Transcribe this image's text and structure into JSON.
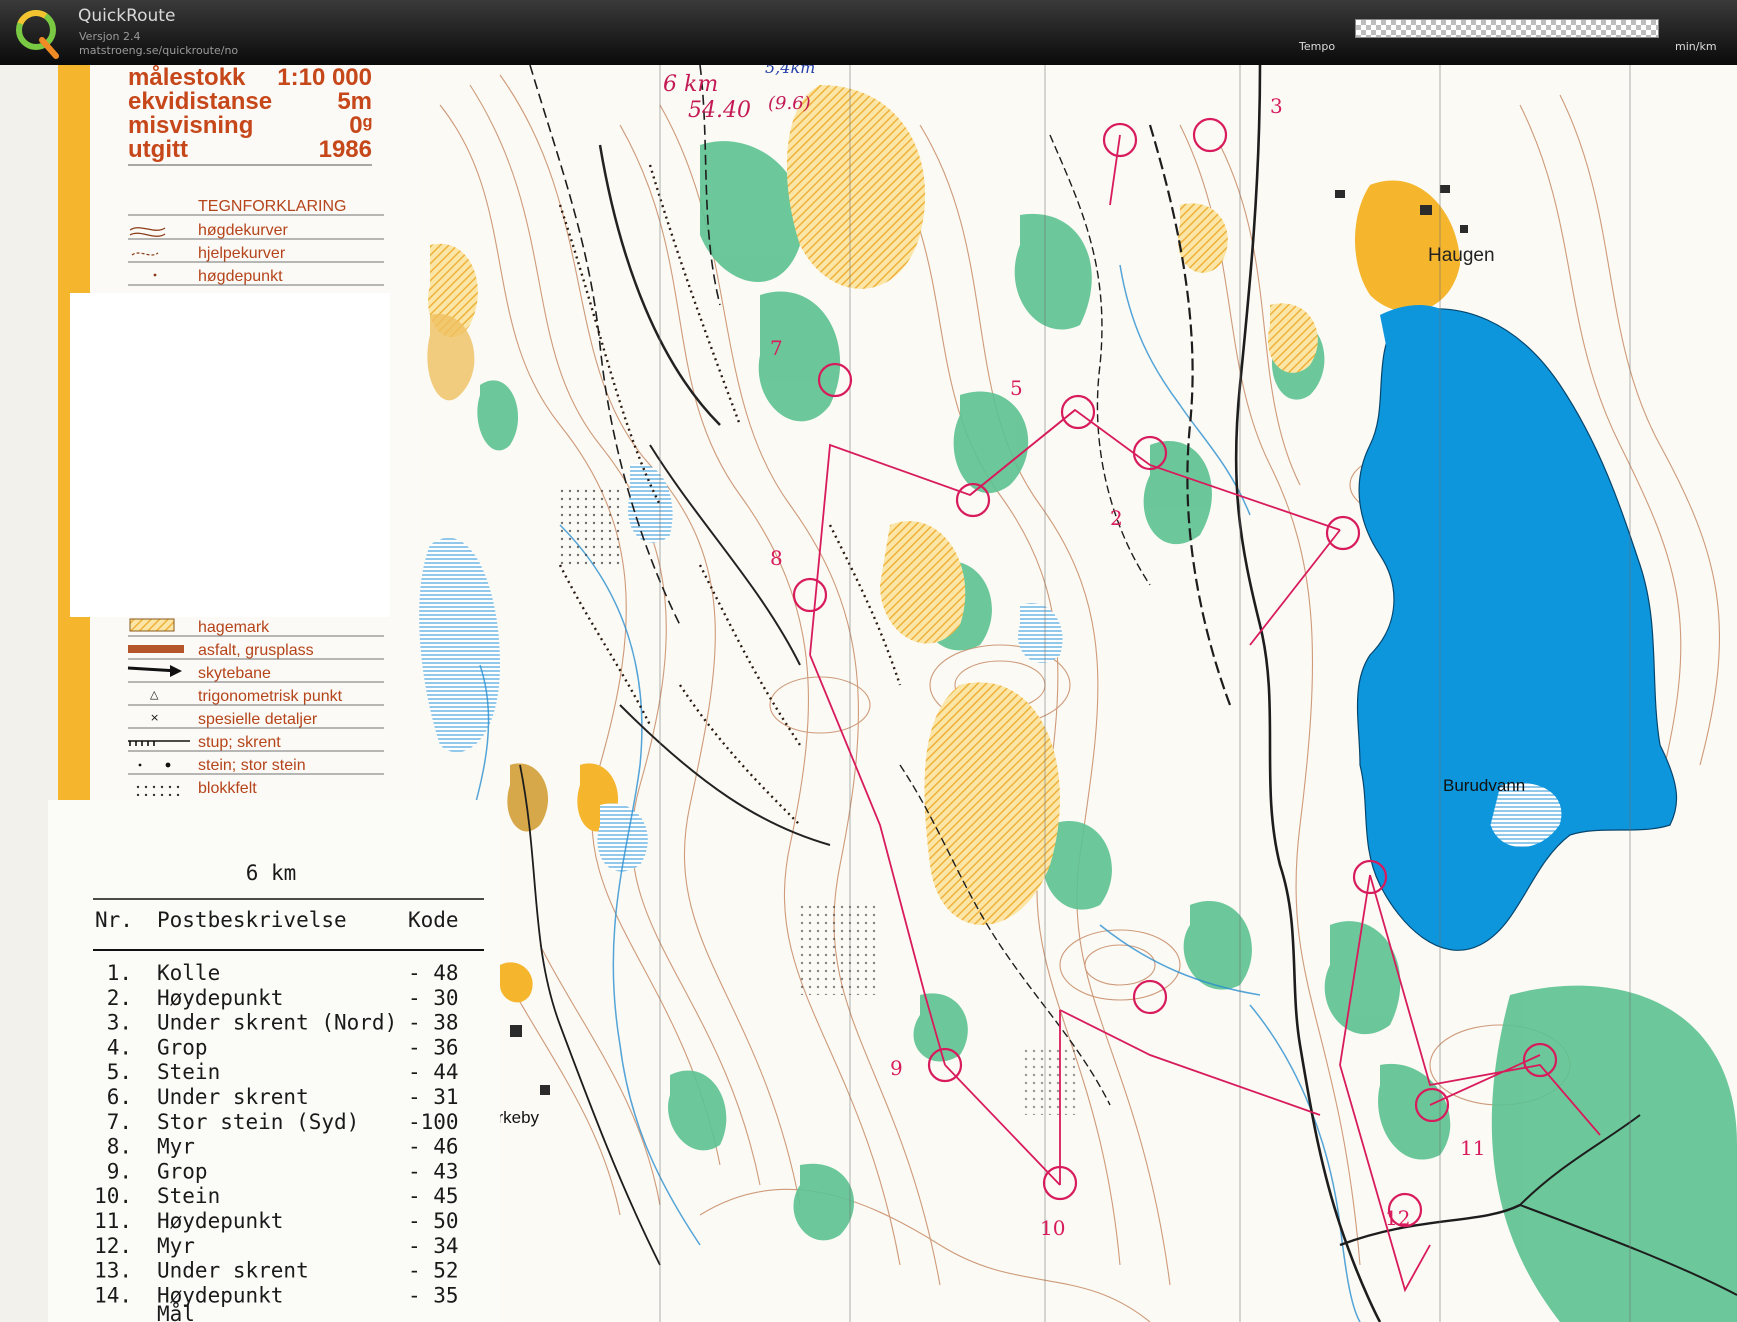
{
  "header": {
    "app_name": "QuickRoute",
    "version": "Versjon 2.4",
    "url": "matstroeng.se/quickroute/no",
    "tempo_label": "Tempo",
    "unit_label": "min/km"
  },
  "map_info": {
    "scale_label": "målestokk",
    "scale_value": "1:10 000",
    "contour_label": "ekvidistanse",
    "contour_value": "5m",
    "declination_label": "misvisning",
    "declination_value": "0ᵍ",
    "published_label": "utgitt",
    "published_value": "1986"
  },
  "legend": {
    "title": "TEGNFORKLARING",
    "top_items": [
      "høgdekurver",
      "hjelpekurver",
      "høgdepunkt"
    ],
    "bottom_items": [
      "hagemark",
      "asfalt, grusplass",
      "skytebane",
      "trigonometrisk punkt",
      "spesielle detaljer",
      "stup; skrent",
      "stein; stor stein",
      "blokkfelt"
    ]
  },
  "place_names": {
    "haugen": "Haugen",
    "lake": "Burudvann",
    "kirkeby": "erkeby"
  },
  "handwritten": {
    "distance": "6 km",
    "time": "54.40",
    "note1": "5,4km",
    "note2": "(9.6)"
  },
  "course_card": {
    "distance": "6 km",
    "col_nr": "Nr.",
    "col_desc": "Postbeskrivelse",
    "col_code": "Kode",
    "controls": [
      {
        "nr": "1.",
        "desc": "Kolle",
        "code": "- 48"
      },
      {
        "nr": "2.",
        "desc": "Høydepunkt",
        "code": "- 30"
      },
      {
        "nr": "3.",
        "desc": "Under skrent (Nord)",
        "code": "- 38"
      },
      {
        "nr": "4.",
        "desc": "Grop",
        "code": "- 36"
      },
      {
        "nr": "5.",
        "desc": "Stein",
        "code": "- 44"
      },
      {
        "nr": "6.",
        "desc": "Under skrent",
        "code": "- 31"
      },
      {
        "nr": "7.",
        "desc": "Stor stein (Syd)",
        "code": "-100"
      },
      {
        "nr": "8.",
        "desc": "Myr",
        "code": "- 46"
      },
      {
        "nr": "9.",
        "desc": "Grop",
        "code": "- 43"
      },
      {
        "nr": "10.",
        "desc": "Stein",
        "code": "- 45"
      },
      {
        "nr": "11.",
        "desc": "Høydepunkt",
        "code": "- 50"
      },
      {
        "nr": "12.",
        "desc": "Myr",
        "code": "- 34"
      },
      {
        "nr": "13.",
        "desc": "Under skrent",
        "code": "- 52"
      },
      {
        "nr": "14.",
        "desc": "Høydepunkt",
        "code": "- 35"
      }
    ],
    "partial_last": "Mål"
  },
  "colors": {
    "water": "#0E96DD",
    "forest_green": "#57C08F",
    "open_yellow": "#F2B632",
    "course_magenta": "#D81B5C",
    "contour_brown": "#B5562A",
    "paper": "#FBFAF6"
  }
}
